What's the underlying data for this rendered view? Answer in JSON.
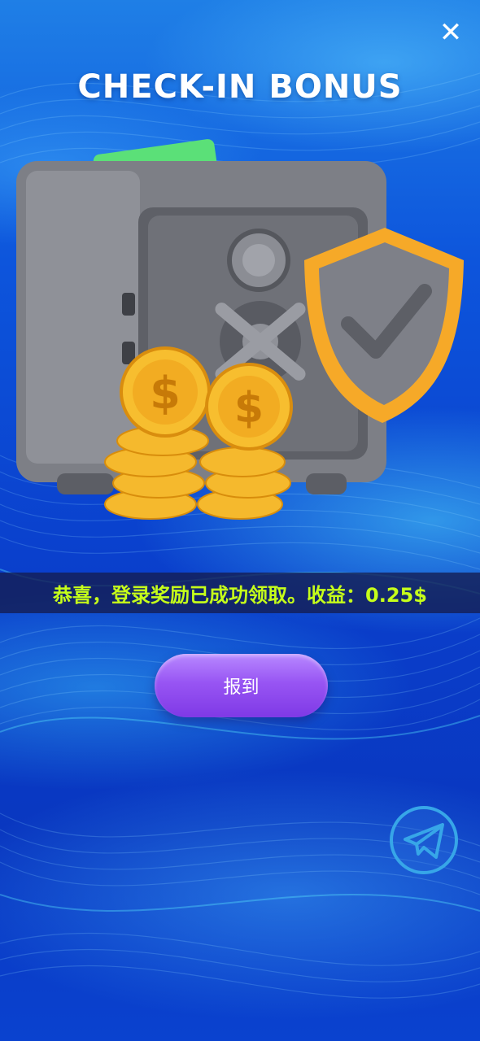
{
  "page": {
    "title": "CHECK-IN BONUS",
    "close_label": "✕"
  },
  "reward": {
    "message": "恭喜，登录奖励已成功领取。收益：0.25$",
    "text_color": "#c6ff1a"
  },
  "actions": {
    "checkin_label": "报到"
  },
  "icons": {
    "close": "close-icon",
    "hero": "safe-with-coins-and-shield-illustration",
    "telegram": "telegram-icon"
  },
  "colors": {
    "background": "#0a3fcc",
    "button": "#9855f3",
    "telegram_ring": "#37a6e8"
  }
}
